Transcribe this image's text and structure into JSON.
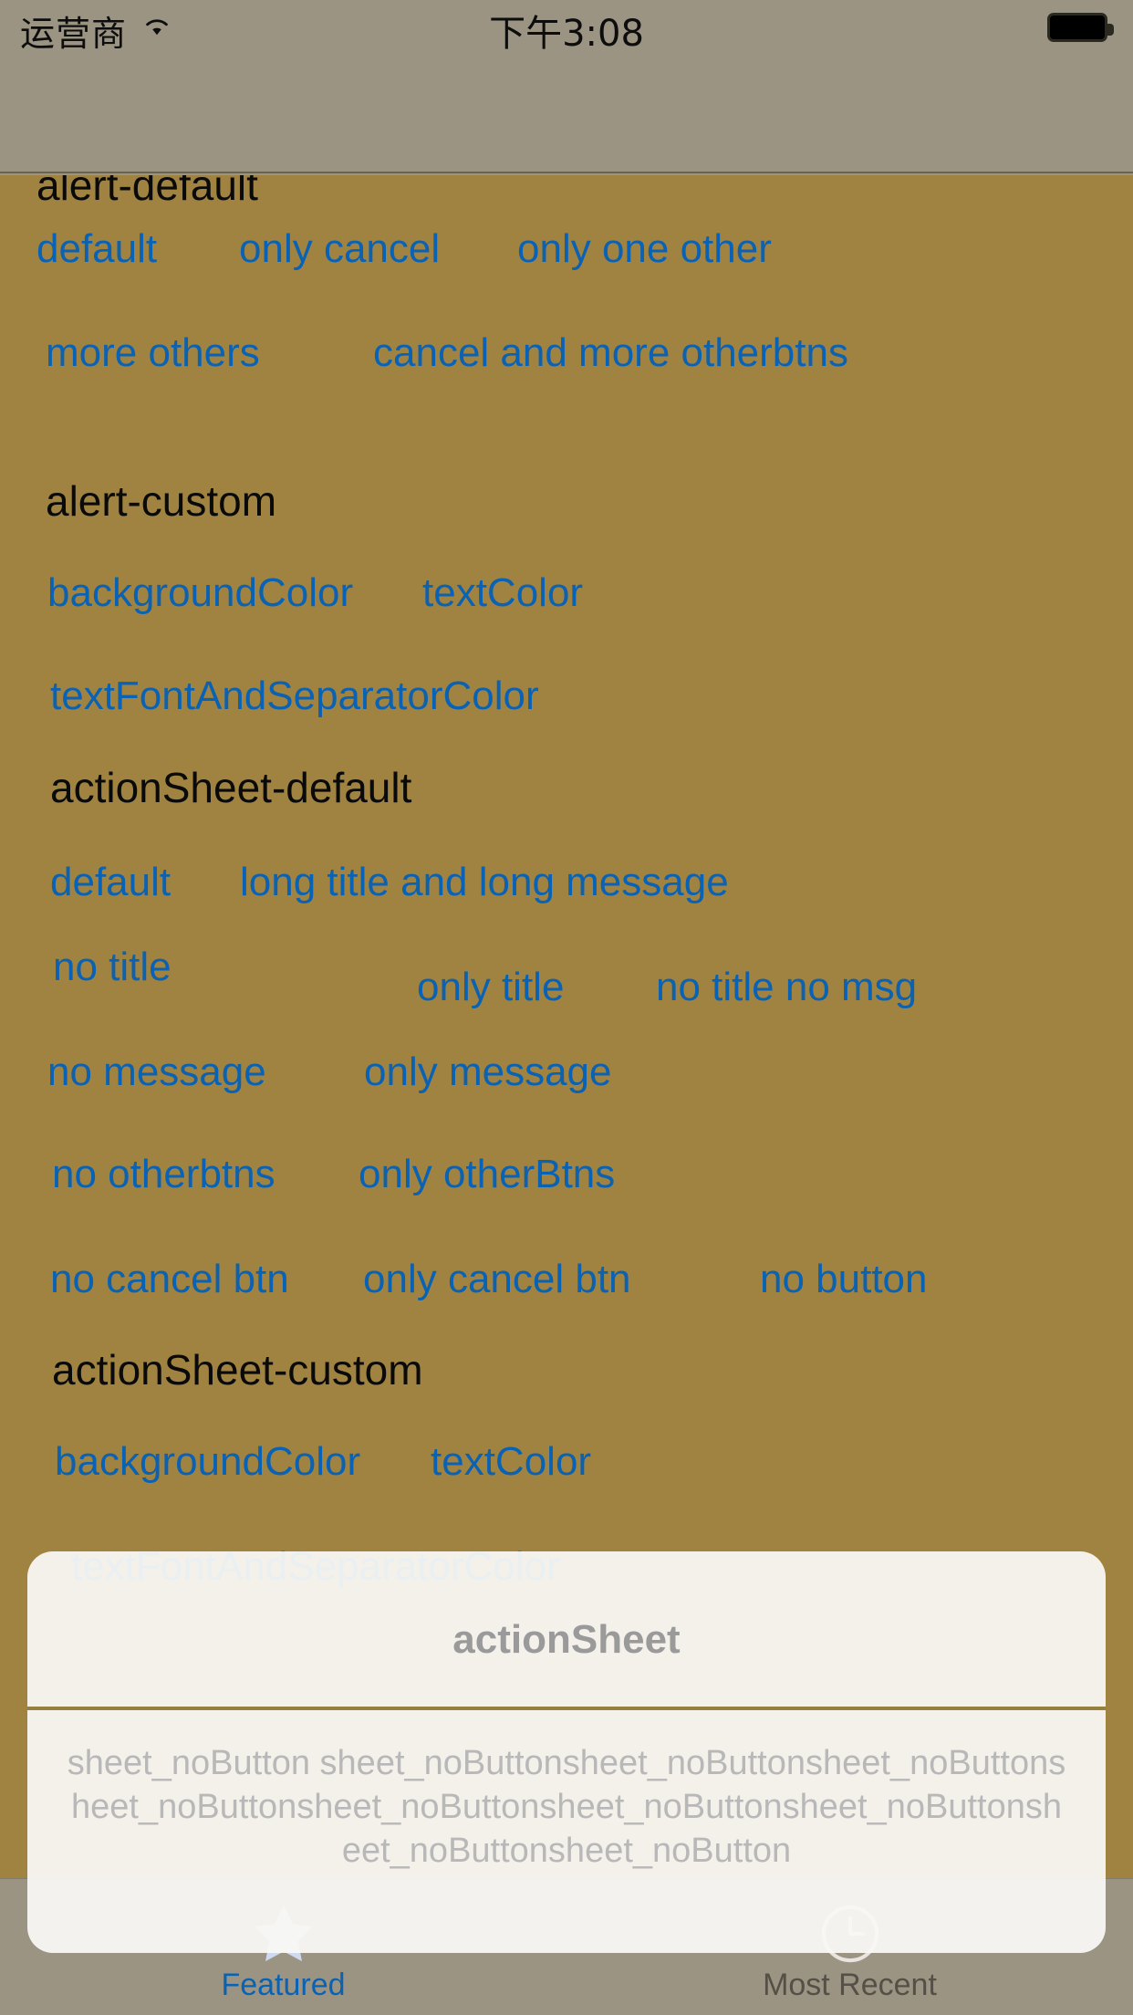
{
  "status_bar": {
    "carrier": "运营商",
    "wifi_icon": "wifi-icon",
    "time": "下午3:08",
    "battery_icon": "battery-full-icon"
  },
  "colors": {
    "content_background": "#a08340",
    "chrome_background": "#9b9483",
    "link_blue": "#0a62b5",
    "sheet_background": "#f9f8f5",
    "separator": "#96803c"
  },
  "content": {
    "sections": [
      {
        "title": "alert-default",
        "rows": [
          [
            "default",
            "only cancel",
            "only one other"
          ],
          [
            "more others",
            "cancel and more otherbtns"
          ]
        ]
      },
      {
        "title": "alert-custom",
        "rows": [
          [
            "backgroundColor",
            "textColor"
          ],
          [
            "textFontAndSeparatorColor"
          ]
        ]
      },
      {
        "title": "actionSheet-default",
        "rows": [
          [
            "default",
            "long title and long message"
          ],
          [
            "no title",
            "only title",
            "no title no msg"
          ],
          [
            "no message",
            "only message"
          ],
          [
            "no otherbtns",
            "only otherBtns"
          ],
          [
            "no cancel btn",
            "only cancel btn",
            "no button"
          ]
        ]
      },
      {
        "title": "actionSheet-custom",
        "rows": [
          [
            "backgroundColor",
            "textColor"
          ],
          [
            "textFontAndSeparatorColor"
          ]
        ]
      }
    ]
  },
  "action_sheet": {
    "title": "actionSheet",
    "message": "sheet_noButton\nsheet_noButtonsheet_noButtonsheet_noButtonsheet_noButtonsheet_noButtonsheet_noButtonsheet_noButtonsheet_noButtonsheet_noButton"
  },
  "tab_bar": {
    "items": [
      {
        "label": "Featured",
        "icon": "star-icon",
        "selected": true
      },
      {
        "label": "Most Recent",
        "icon": "clock-icon",
        "selected": false
      }
    ]
  }
}
